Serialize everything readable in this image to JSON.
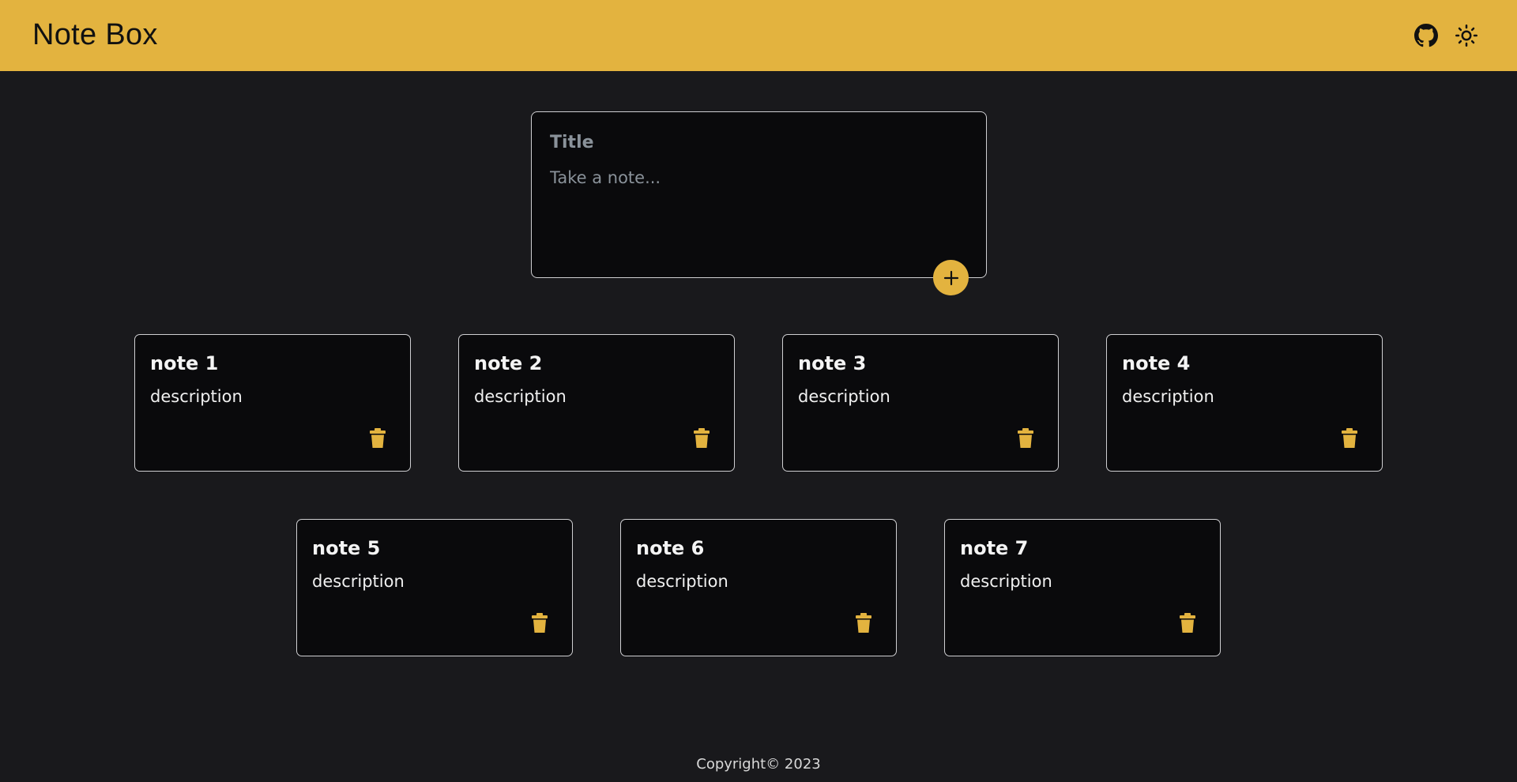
{
  "header": {
    "brand": "Note Box",
    "background": "#e3b33f",
    "icons": [
      "github-icon",
      "sun-icon"
    ]
  },
  "composer": {
    "title_placeholder": "Title",
    "body_placeholder": "Take a note...",
    "add_icon": "plus-icon"
  },
  "notes": [
    {
      "title": "note 1",
      "description": "description"
    },
    {
      "title": "note 2",
      "description": "description"
    },
    {
      "title": "note 3",
      "description": "description"
    },
    {
      "title": "note 4",
      "description": "description"
    },
    {
      "title": "note 5",
      "description": "description"
    },
    {
      "title": "note 6",
      "description": "description"
    },
    {
      "title": "note 7",
      "description": "description"
    }
  ],
  "footer": {
    "copyright": "Copyright© 2023"
  },
  "colors": {
    "accent": "#e3b33f",
    "page_background": "#19191c",
    "card_background": "#0a0a0c"
  }
}
